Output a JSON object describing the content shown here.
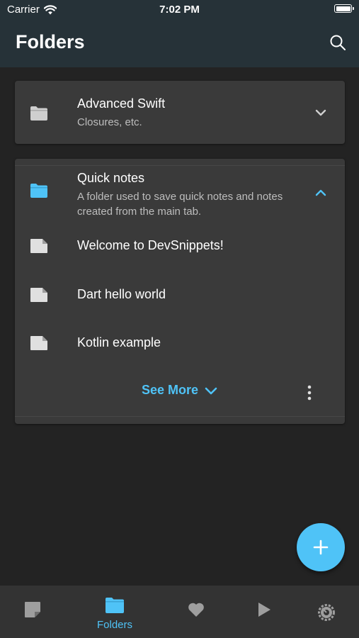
{
  "status_bar": {
    "carrier": "Carrier",
    "time": "7:02 PM"
  },
  "header": {
    "title": "Folders"
  },
  "folders": [
    {
      "title": "Advanced Swift",
      "description": "Closures, etc.",
      "expanded": false,
      "color": "#cfcfcf"
    },
    {
      "title": "Quick notes",
      "description": "A folder used to save quick notes and notes created from the main tab.",
      "expanded": true,
      "color": "#4fc3f7"
    }
  ],
  "notes": [
    {
      "title": "Welcome to DevSnippets!"
    },
    {
      "title": "Dart hello world"
    },
    {
      "title": "Kotlin example"
    }
  ],
  "see_more_label": "See More",
  "bottom_nav": {
    "active": "Folders",
    "items": [
      {
        "icon": "note-icon",
        "label": ""
      },
      {
        "icon": "folder-icon",
        "label": "Folders"
      },
      {
        "icon": "heart-icon",
        "label": ""
      },
      {
        "icon": "play-icon",
        "label": ""
      },
      {
        "icon": "settings-icon",
        "label": ""
      }
    ]
  },
  "colors": {
    "accent": "#4fc3f7",
    "background": "#232323",
    "card": "#3a3a3a",
    "header": "#263238",
    "nav": "#333333"
  }
}
